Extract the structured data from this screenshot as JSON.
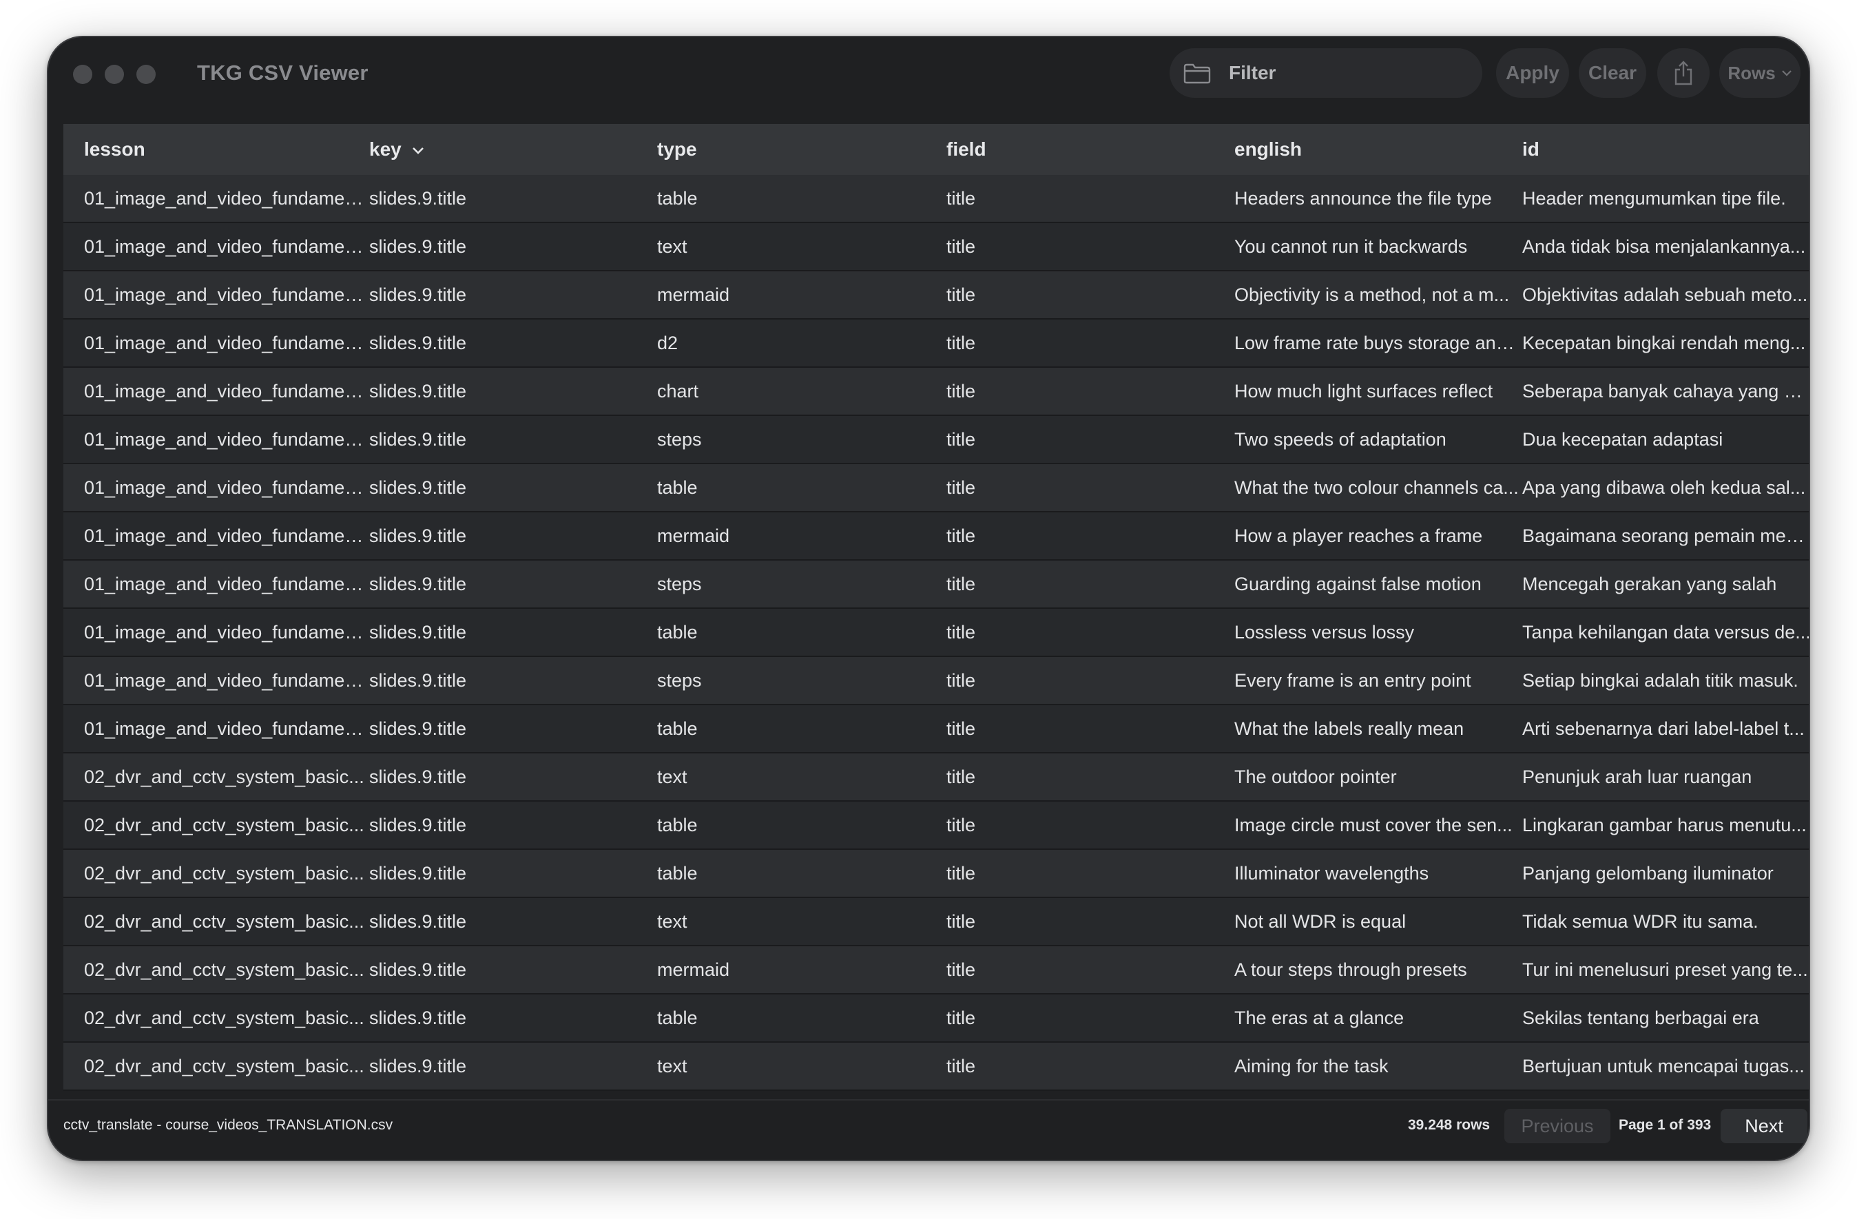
{
  "app": {
    "title": "TKG CSV Viewer"
  },
  "toolbar": {
    "filter_placeholder": "Filter",
    "apply_label": "Apply",
    "clear_label": "Clear",
    "rows_label": "Rows",
    "icons": [
      "folder-icon",
      "share-icon",
      "chevron-down-icon"
    ]
  },
  "table": {
    "columns": [
      "lesson",
      "key",
      "type",
      "field",
      "english",
      "id"
    ],
    "sorted_column": "key",
    "rows": [
      [
        "01_image_and_video_fundamen...",
        "slides.9.title",
        "table",
        "title",
        "Headers announce the file type",
        "Header mengumumkan tipe file."
      ],
      [
        "01_image_and_video_fundamen...",
        "slides.9.title",
        "text",
        "title",
        "You cannot run it backwards",
        "Anda tidak bisa menjalankannya..."
      ],
      [
        "01_image_and_video_fundamen...",
        "slides.9.title",
        "mermaid",
        "title",
        "Objectivity is a method, not a m...",
        "Objektivitas adalah sebuah meto..."
      ],
      [
        "01_image_and_video_fundamen...",
        "slides.9.title",
        "d2",
        "title",
        "Low frame rate buys storage and...",
        "Kecepatan bingkai rendah meng..."
      ],
      [
        "01_image_and_video_fundamen...",
        "slides.9.title",
        "chart",
        "title",
        "How much light surfaces reflect",
        "Seberapa banyak cahaya yang di..."
      ],
      [
        "01_image_and_video_fundamen...",
        "slides.9.title",
        "steps",
        "title",
        "Two speeds of adaptation",
        "Dua kecepatan adaptasi"
      ],
      [
        "01_image_and_video_fundamen...",
        "slides.9.title",
        "table",
        "title",
        "What the two colour channels ca...",
        "Apa yang dibawa oleh kedua sal..."
      ],
      [
        "01_image_and_video_fundamen...",
        "slides.9.title",
        "mermaid",
        "title",
        "How a player reaches a frame",
        "Bagaimana seorang pemain men..."
      ],
      [
        "01_image_and_video_fundamen...",
        "slides.9.title",
        "steps",
        "title",
        "Guarding against false motion",
        "Mencegah gerakan yang salah"
      ],
      [
        "01_image_and_video_fundamen...",
        "slides.9.title",
        "table",
        "title",
        "Lossless versus lossy",
        "Tanpa kehilangan data versus de..."
      ],
      [
        "01_image_and_video_fundamen...",
        "slides.9.title",
        "steps",
        "title",
        "Every frame is an entry point",
        "Setiap bingkai adalah titik masuk."
      ],
      [
        "01_image_and_video_fundamen...",
        "slides.9.title",
        "table",
        "title",
        "What the labels really mean",
        "Arti sebenarnya dari label-label t..."
      ],
      [
        "02_dvr_and_cctv_system_basic...",
        "slides.9.title",
        "text",
        "title",
        "The outdoor pointer",
        "Penunjuk arah luar ruangan"
      ],
      [
        "02_dvr_and_cctv_system_basic...",
        "slides.9.title",
        "table",
        "title",
        "Image circle must cover the sen...",
        "Lingkaran gambar harus menutu..."
      ],
      [
        "02_dvr_and_cctv_system_basic...",
        "slides.9.title",
        "table",
        "title",
        "Illuminator wavelengths",
        "Panjang gelombang iluminator"
      ],
      [
        "02_dvr_and_cctv_system_basic...",
        "slides.9.title",
        "text",
        "title",
        "Not all WDR is equal",
        "Tidak semua WDR itu sama."
      ],
      [
        "02_dvr_and_cctv_system_basic...",
        "slides.9.title",
        "mermaid",
        "title",
        "A tour steps through presets",
        "Tur ini menelusuri preset yang te..."
      ],
      [
        "02_dvr_and_cctv_system_basic...",
        "slides.9.title",
        "table",
        "title",
        "The eras at a glance",
        "Sekilas tentang berbagai era"
      ],
      [
        "02_dvr_and_cctv_system_basic...",
        "slides.9.title",
        "text",
        "title",
        "Aiming for the task",
        "Bertujuan untuk mencapai tugas..."
      ]
    ]
  },
  "footer": {
    "file_label": "cctv_translate - course_videos_TRANSLATION.csv",
    "row_count": "39.248 rows",
    "prev_label": "Previous",
    "page_label": "Page 1 of 393",
    "next_label": "Next"
  }
}
